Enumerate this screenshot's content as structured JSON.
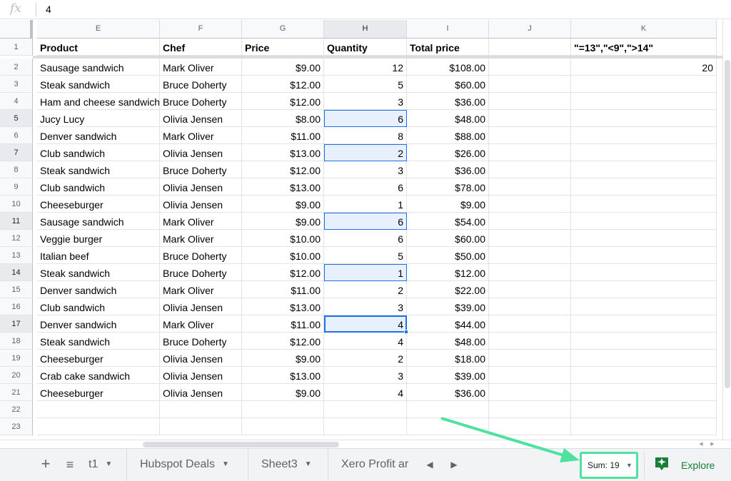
{
  "formula_bar": {
    "icon": "fx",
    "value": "4"
  },
  "columns": [
    {
      "letter": "E"
    },
    {
      "letter": "F"
    },
    {
      "letter": "G"
    },
    {
      "letter": "H"
    },
    {
      "letter": "I"
    },
    {
      "letter": "J"
    },
    {
      "letter": "K"
    }
  ],
  "selected_column": "H",
  "header_row": {
    "number": "1",
    "cells": [
      "Product",
      "Chef",
      "Price",
      "Quantity",
      "Total price",
      "",
      "\"=13\",\"<9\",\">14\""
    ]
  },
  "rows": [
    {
      "n": "2",
      "product": "Sausage sandwich",
      "chef": "Mark Oliver",
      "price": "$9.00",
      "qty": "12",
      "total": "$108.00",
      "k": "20"
    },
    {
      "n": "3",
      "product": "Steak sandwich",
      "chef": "Bruce Doherty",
      "price": "$12.00",
      "qty": "5",
      "total": "$60.00",
      "k": ""
    },
    {
      "n": "4",
      "product": "Ham and cheese sandwich",
      "chef": "Bruce Doherty",
      "price": "$12.00",
      "qty": "3",
      "total": "$36.00",
      "k": ""
    },
    {
      "n": "5",
      "product": "Jucy Lucy",
      "chef": "Olivia Jensen",
      "price": "$8.00",
      "qty": "6",
      "total": "$48.00",
      "k": ""
    },
    {
      "n": "6",
      "product": "Denver sandwich",
      "chef": "Mark Oliver",
      "price": "$11.00",
      "qty": "8",
      "total": "$88.00",
      "k": ""
    },
    {
      "n": "7",
      "product": "Club sandwich",
      "chef": "Olivia Jensen",
      "price": "$13.00",
      "qty": "2",
      "total": "$26.00",
      "k": ""
    },
    {
      "n": "8",
      "product": "Steak sandwich",
      "chef": "Bruce Doherty",
      "price": "$12.00",
      "qty": "3",
      "total": "$36.00",
      "k": ""
    },
    {
      "n": "9",
      "product": "Club sandwich",
      "chef": "Olivia Jensen",
      "price": "$13.00",
      "qty": "6",
      "total": "$78.00",
      "k": ""
    },
    {
      "n": "10",
      "product": "Cheeseburger",
      "chef": "Olivia Jensen",
      "price": "$9.00",
      "qty": "1",
      "total": "$9.00",
      "k": ""
    },
    {
      "n": "11",
      "product": "Sausage sandwich",
      "chef": "Mark Oliver",
      "price": "$9.00",
      "qty": "6",
      "total": "$54.00",
      "k": ""
    },
    {
      "n": "12",
      "product": "Veggie burger",
      "chef": "Mark Oliver",
      "price": "$10.00",
      "qty": "6",
      "total": "$60.00",
      "k": ""
    },
    {
      "n": "13",
      "product": "Italian beef",
      "chef": "Bruce Doherty",
      "price": "$10.00",
      "qty": "5",
      "total": "$50.00",
      "k": ""
    },
    {
      "n": "14",
      "product": "Steak sandwich",
      "chef": "Bruce Doherty",
      "price": "$12.00",
      "qty": "1",
      "total": "$12.00",
      "k": ""
    },
    {
      "n": "15",
      "product": "Denver sandwich",
      "chef": "Mark Oliver",
      "price": "$11.00",
      "qty": "2",
      "total": "$22.00",
      "k": ""
    },
    {
      "n": "16",
      "product": "Club sandwich",
      "chef": "Olivia Jensen",
      "price": "$13.00",
      "qty": "3",
      "total": "$39.00",
      "k": ""
    },
    {
      "n": "17",
      "product": "Denver sandwich",
      "chef": "Mark Oliver",
      "price": "$11.00",
      "qty": "4",
      "total": "$44.00",
      "k": ""
    },
    {
      "n": "18",
      "product": "Steak sandwich",
      "chef": "Bruce Doherty",
      "price": "$12.00",
      "qty": "4",
      "total": "$48.00",
      "k": ""
    },
    {
      "n": "19",
      "product": "Cheeseburger",
      "chef": "Olivia Jensen",
      "price": "$9.00",
      "qty": "2",
      "total": "$18.00",
      "k": ""
    },
    {
      "n": "20",
      "product": "Crab cake sandwich",
      "chef": "Olivia Jensen",
      "price": "$13.00",
      "qty": "3",
      "total": "$39.00",
      "k": ""
    },
    {
      "n": "21",
      "product": "Cheeseburger",
      "chef": "Olivia Jensen",
      "price": "$9.00",
      "qty": "4",
      "total": "$36.00",
      "k": ""
    },
    {
      "n": "22",
      "product": "",
      "chef": "",
      "price": "",
      "qty": "",
      "total": "",
      "k": ""
    },
    {
      "n": "23",
      "product": "",
      "chef": "",
      "price": "",
      "qty": "",
      "total": "",
      "k": ""
    }
  ],
  "selected_rows": [
    "5",
    "7",
    "11",
    "14",
    "17"
  ],
  "active_row": "17",
  "sheet_tabs": [
    {
      "label": "t1"
    },
    {
      "label": "Hubspot Deals"
    },
    {
      "label": "Sheet3"
    },
    {
      "label": "Xero Profit ar"
    }
  ],
  "bottom_bar": {
    "add_icon": "+",
    "all_sheets_icon": "≡",
    "sum_label": "Sum: 19",
    "explore_label": "Explore"
  },
  "colors": {
    "selection_fill": "#e8f0fe",
    "selection_border": "#1a73e8",
    "annotation": "#4ee1a0",
    "explore_green": "#188038"
  }
}
